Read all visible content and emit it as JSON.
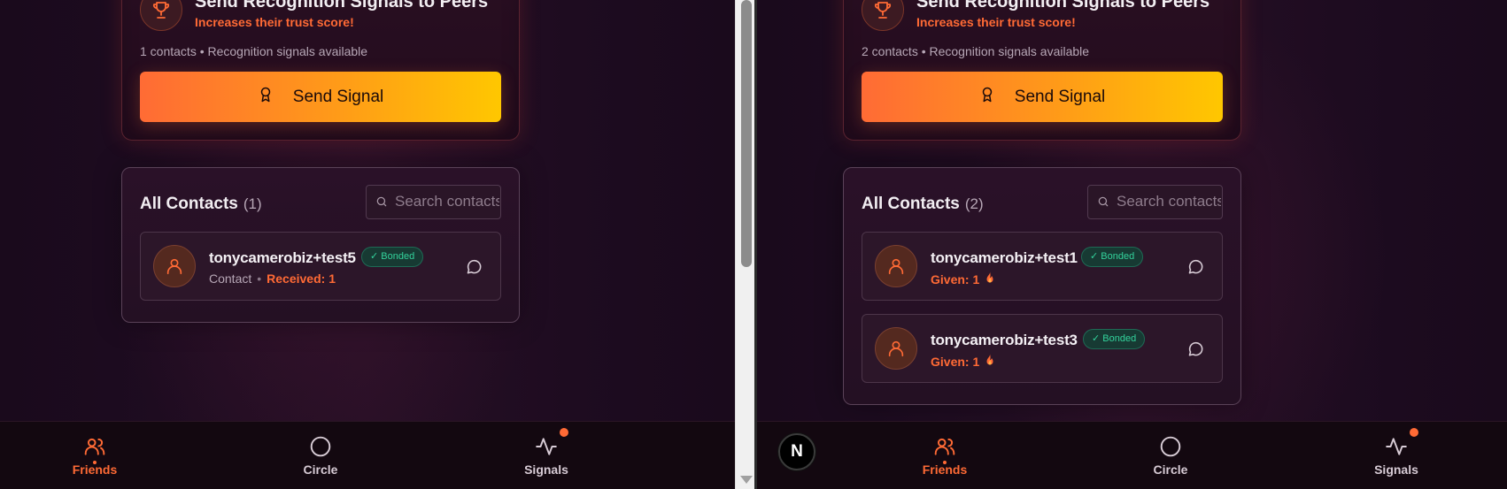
{
  "panes": {
    "left": {
      "signal_card": {
        "title": "Send Recognition Signals to Peers",
        "subtitle": "Increases their trust score!",
        "availability": "1 contacts • Recognition signals available",
        "button_label": "Send Signal"
      },
      "contacts": {
        "title": "All Contacts",
        "count": "(1)",
        "search_placeholder": "Search contacts",
        "items": [
          {
            "name": "tonycamerobiz+test5",
            "badge": "✓ Bonded",
            "role": "Contact",
            "separator": "•",
            "stat": "Received: 1"
          }
        ]
      }
    },
    "right": {
      "signal_card": {
        "title": "Send Recognition Signals to Peers",
        "subtitle": "Increases their trust score!",
        "availability": "2 contacts • Recognition signals available",
        "button_label": "Send Signal"
      },
      "contacts": {
        "title": "All Contacts",
        "count": "(2)",
        "search_placeholder": "Search contacts",
        "items": [
          {
            "name": "tonycamerobiz+test1",
            "badge": "✓ Bonded",
            "stat": "Given: 1"
          },
          {
            "name": "tonycamerobiz+test3",
            "badge": "✓ Bonded",
            "stat": "Given: 1"
          }
        ]
      }
    }
  },
  "nav": {
    "items": [
      {
        "label": "Friends",
        "icon": "users-icon",
        "active": true
      },
      {
        "label": "Circle",
        "icon": "circle-icon",
        "active": false
      },
      {
        "label": "Signals",
        "icon": "activity-icon",
        "active": false,
        "notification": true
      }
    ]
  },
  "dev_badge": {
    "letter": "N"
  },
  "colors": {
    "accent": "#ff6a35",
    "gradient_start": "#ff6b35",
    "gradient_end": "#ffc700",
    "bonded": "#33d39c",
    "background": "#1c0b1f"
  }
}
